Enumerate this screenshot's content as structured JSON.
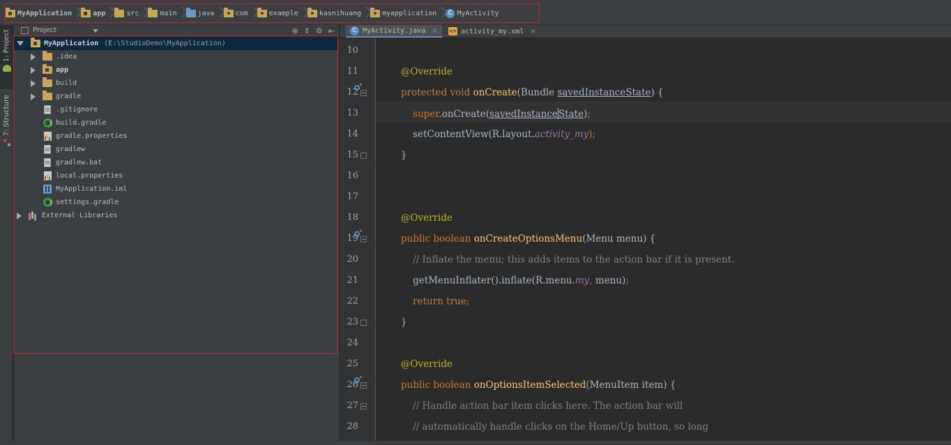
{
  "breadcrumbs": [
    {
      "label": "MyApplication",
      "icon": "module-folder-icon",
      "bold": true
    },
    {
      "label": "app",
      "icon": "module-folder-icon",
      "bold": true
    },
    {
      "label": "src",
      "icon": "folder-icon",
      "bold": false
    },
    {
      "label": "main",
      "icon": "folder-icon",
      "bold": false
    },
    {
      "label": "java",
      "icon": "source-folder-icon",
      "bold": false
    },
    {
      "label": "com",
      "icon": "package-icon",
      "bold": false
    },
    {
      "label": "example",
      "icon": "package-icon",
      "bold": false
    },
    {
      "label": "kasnihuang",
      "icon": "package-icon",
      "bold": false
    },
    {
      "label": "myapplication",
      "icon": "package-icon",
      "bold": false
    },
    {
      "label": "MyActivity",
      "icon": "class-icon",
      "bold": false
    }
  ],
  "toolstrip": {
    "project_tab": "1: Project",
    "structure_tab": "7: Structure"
  },
  "project_panel": {
    "view_label": "Project",
    "tools": {
      "sync": "⊕",
      "collapse": "⇕",
      "settings": "⚙",
      "hide": "⇤"
    },
    "tree": [
      {
        "name": "MyApplication",
        "path": "(E:\\StudioDemo\\MyApplication)",
        "icon": "module-folder-icon",
        "level": 0,
        "arrow": "down",
        "bold": true,
        "selected": true
      },
      {
        "name": ".idea",
        "icon": "folder-icon",
        "level": 1,
        "arrow": "right"
      },
      {
        "name": "app",
        "icon": "module-folder-icon",
        "level": 1,
        "arrow": "right",
        "bold": true
      },
      {
        "name": "build",
        "icon": "folder-icon",
        "level": 1,
        "arrow": "right"
      },
      {
        "name": "gradle",
        "icon": "folder-icon",
        "level": 1,
        "arrow": "right"
      },
      {
        "name": ".gitignore",
        "icon": "text-file-icon",
        "level": 1
      },
      {
        "name": "build.gradle",
        "icon": "gradle-icon",
        "level": 1
      },
      {
        "name": "gradle.properties",
        "icon": "properties-icon",
        "level": 1
      },
      {
        "name": "gradlew",
        "icon": "text-file-icon",
        "level": 1
      },
      {
        "name": "gradlew.bat",
        "icon": "text-file-icon",
        "level": 1
      },
      {
        "name": "local.properties",
        "icon": "properties-icon",
        "level": 1
      },
      {
        "name": "MyApplication.iml",
        "icon": "iml-icon",
        "level": 1
      },
      {
        "name": "settings.gradle",
        "icon": "gradle-icon",
        "level": 1
      },
      {
        "name": "External Libraries",
        "icon": "libraries-icon",
        "level": 0,
        "arrow": "right"
      }
    ]
  },
  "editor": {
    "tabs": [
      {
        "label": "MyActivity.java",
        "icon": "class-icon",
        "active": true,
        "close": "×"
      },
      {
        "label": "activity_my.xml",
        "icon": "xml-icon",
        "active": false,
        "close": "×"
      }
    ],
    "lines": [
      {
        "num": "10",
        "tokens": []
      },
      {
        "num": "11",
        "tokens": [
          {
            "t": "@Override",
            "c": "a"
          }
        ]
      },
      {
        "num": "12",
        "marker": true,
        "fold": "start",
        "tokens": [
          {
            "t": "protected void ",
            "c": "k"
          },
          {
            "t": "onCreate",
            "c": "f"
          },
          {
            "t": "(Bundle "
          },
          {
            "t": "savedInstanceState",
            "c": "u"
          },
          {
            "t": ") {"
          }
        ]
      },
      {
        "num": "13",
        "current": true,
        "tokens": [
          {
            "t": "    "
          },
          {
            "t": "super",
            "c": "k"
          },
          {
            "t": ".onCreate("
          },
          {
            "t": "savedInstance",
            "c": "u"
          },
          {
            "caret": true
          },
          {
            "t": "State",
            "c": "u"
          },
          {
            "t": ")"
          },
          {
            "t": ";",
            "c": "k"
          }
        ]
      },
      {
        "num": "14",
        "tokens": [
          {
            "t": "    setContentView(R.layout."
          },
          {
            "t": "activity_my",
            "c": "i"
          },
          {
            "t": ");",
            "c": "k"
          }
        ]
      },
      {
        "num": "15",
        "fold": "end",
        "tokens": [
          {
            "t": "}"
          }
        ]
      },
      {
        "num": "16",
        "tokens": []
      },
      {
        "num": "17",
        "tokens": []
      },
      {
        "num": "18",
        "tokens": [
          {
            "t": "@Override",
            "c": "a"
          }
        ]
      },
      {
        "num": "19",
        "marker": true,
        "fold": "start",
        "tokens": [
          {
            "t": "public boolean ",
            "c": "k"
          },
          {
            "t": "onCreateOptionsMenu",
            "c": "f"
          },
          {
            "t": "(Menu menu) {"
          }
        ]
      },
      {
        "num": "20",
        "tokens": [
          {
            "t": "    "
          },
          {
            "t": "// Inflate the menu; this adds items to the action bar if it is present.",
            "c": "c"
          }
        ]
      },
      {
        "num": "21",
        "tokens": [
          {
            "t": "    getMenuInflater().inflate(R.menu."
          },
          {
            "t": "my",
            "c": "i"
          },
          {
            "t": ", ",
            "c": "k"
          },
          {
            "t": "menu)"
          },
          {
            "t": ";",
            "c": "k"
          }
        ]
      },
      {
        "num": "22",
        "tokens": [
          {
            "t": "    "
          },
          {
            "t": "return true;",
            "c": "k"
          }
        ]
      },
      {
        "num": "23",
        "fold": "end",
        "tokens": [
          {
            "t": "}"
          }
        ]
      },
      {
        "num": "24",
        "tokens": []
      },
      {
        "num": "25",
        "tokens": [
          {
            "t": "@Override",
            "c": "a"
          }
        ]
      },
      {
        "num": "26",
        "marker": true,
        "fold": "start",
        "tokens": [
          {
            "t": "public boolean ",
            "c": "k"
          },
          {
            "t": "onOptionsItemSelected",
            "c": "f"
          },
          {
            "t": "(MenuItem item) {"
          }
        ]
      },
      {
        "num": "27",
        "fold": "start",
        "tokens": [
          {
            "t": "    "
          },
          {
            "t": "// Handle action bar item clicks here. The action bar will",
            "c": "c"
          }
        ]
      },
      {
        "num": "28",
        "tokens": [
          {
            "t": "    "
          },
          {
            "t": "// automatically handle clicks on the Home/Up button, so long",
            "c": "c"
          }
        ]
      }
    ]
  }
}
